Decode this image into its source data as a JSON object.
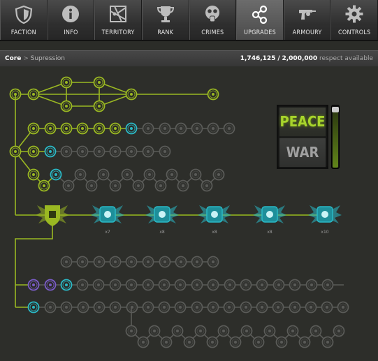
{
  "nav": {
    "tabs": [
      {
        "label": "FACTION",
        "icon": "shield-icon"
      },
      {
        "label": "INFO",
        "icon": "info-icon"
      },
      {
        "label": "TERRITORY",
        "icon": "territory-map-icon"
      },
      {
        "label": "RANK",
        "icon": "trophy-icon"
      },
      {
        "label": "CRIMES",
        "icon": "gas-mask-icon"
      },
      {
        "label": "UPGRADES",
        "icon": "share-nodes-icon",
        "active": true
      },
      {
        "label": "ARMOURY",
        "icon": "revolver-icon"
      },
      {
        "label": "CONTROLS",
        "icon": "gear-icon"
      }
    ]
  },
  "header": {
    "crumb_root": "Core",
    "crumb_sep": ">",
    "crumb_sub": "Supression",
    "respect_current": "1,746,125",
    "respect_sep": "/",
    "respect_max": "2,000,000",
    "respect_suffix": "respect available"
  },
  "mode": {
    "peace_label": "PEACE",
    "war_label": "WAR",
    "selected": "PEACE",
    "level": 0.9
  },
  "branches": [
    {
      "badge": "",
      "icon": "shield-castle-icon"
    },
    {
      "badge": "x7",
      "icon": "winged-lightning-icon"
    },
    {
      "badge": "x8",
      "icon": "winged-medkit-icon"
    },
    {
      "badge": "x8",
      "icon": "skull-burst-icon"
    },
    {
      "badge": "x8",
      "icon": "toxic-medkit-icon"
    },
    {
      "badge": "x10",
      "icon": "caduceus-icon"
    }
  ],
  "colors": {
    "unlocked": "#9ab822",
    "available": "#2ab9c6",
    "locked": "#5a5b58",
    "war_debuff": "#7a5cc7",
    "active_line": "#8aa81f"
  }
}
